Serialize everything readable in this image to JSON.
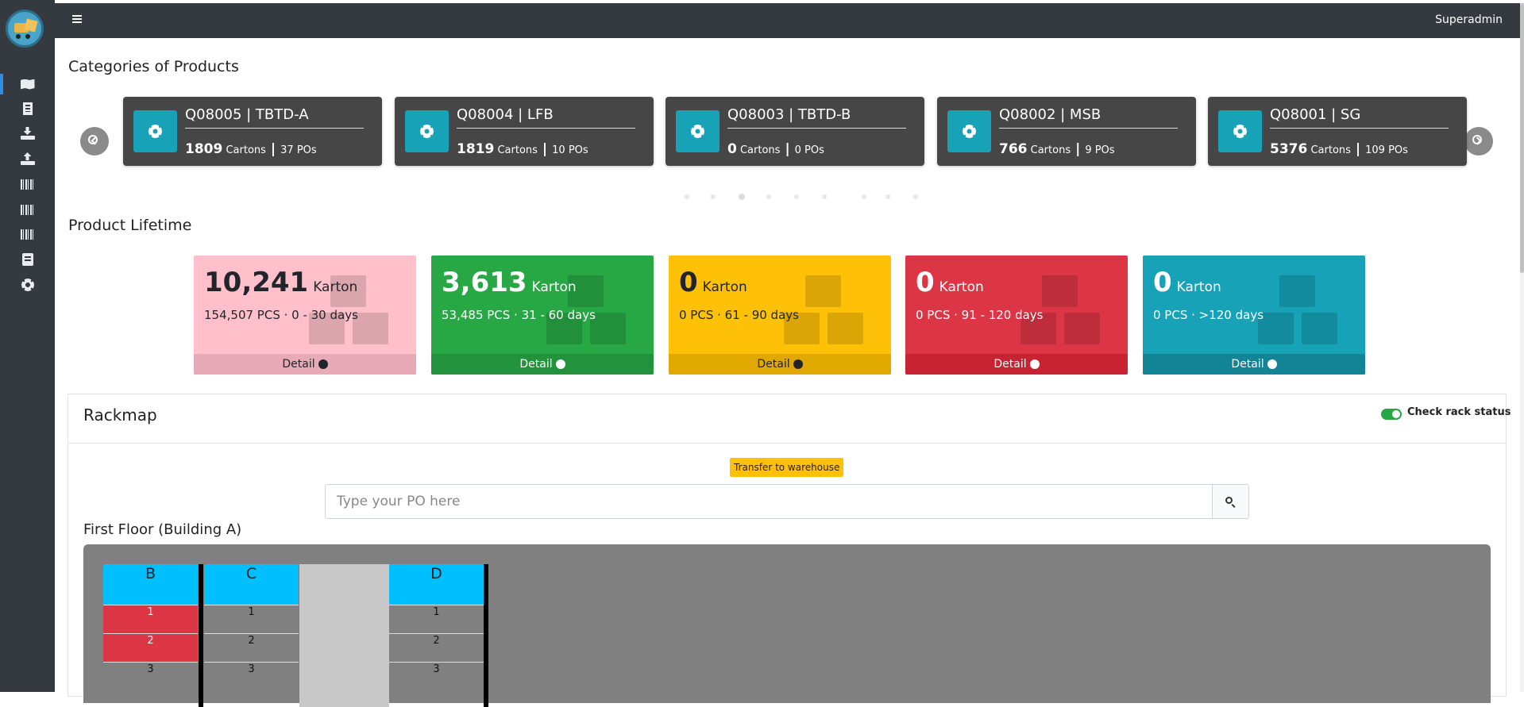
{
  "topbar": {
    "user": "Superadmin"
  },
  "sidebar": {
    "items": [
      {
        "icon": "map-icon",
        "active": true
      },
      {
        "icon": "building-icon"
      },
      {
        "icon": "download-icon"
      },
      {
        "icon": "upload-icon"
      },
      {
        "icon": "barcode-icon"
      },
      {
        "icon": "barcode-icon"
      },
      {
        "icon": "barcode-icon"
      },
      {
        "icon": "book-icon"
      },
      {
        "icon": "gear-icon"
      }
    ]
  },
  "categories": {
    "title": "Categories of Products",
    "cards": [
      {
        "code": "Q08005 | TBTD-A",
        "cartons": "1809",
        "cartons_label": "Cartons",
        "pos": "37 POs"
      },
      {
        "code": "Q08004 | LFB",
        "cartons": "1819",
        "cartons_label": "Cartons",
        "pos": "10 POs"
      },
      {
        "code": "Q08003 | TBTD-B",
        "cartons": "0",
        "cartons_label": "Cartons",
        "pos": "0 POs"
      },
      {
        "code": "Q08002 | MSB",
        "cartons": "766",
        "cartons_label": "Cartons",
        "pos": "9 POs"
      },
      {
        "code": "Q08001 | SG",
        "cartons": "5376",
        "cartons_label": "Cartons",
        "pos": "109 POs"
      }
    ]
  },
  "lifetime": {
    "title": "Product Lifetime",
    "cards": [
      {
        "value": "10,241",
        "unit": "Karton",
        "desc": "154,507 PCS · 0 - 30 days",
        "detail": "Detail",
        "bg": "#ffc0cb",
        "footer": "#e8aab6",
        "text": "#212529"
      },
      {
        "value": "3,613",
        "unit": "Karton",
        "desc": "53,485 PCS · 31 - 60 days",
        "detail": "Detail",
        "bg": "#28a745",
        "footer": "#23923d",
        "text": "#ffffff"
      },
      {
        "value": "0",
        "unit": "Karton",
        "desc": "0 PCS · 61 - 90 days",
        "detail": "Detail",
        "bg": "#ffc107",
        "footer": "#e0a800",
        "text": "#212529"
      },
      {
        "value": "0",
        "unit": "Karton",
        "desc": "0 PCS · 91 - 120 days",
        "detail": "Detail",
        "bg": "#dc3545",
        "footer": "#c82333",
        "text": "#ffffff"
      },
      {
        "value": "0",
        "unit": "Karton",
        "desc": "0 PCS · >120 days",
        "detail": "Detail",
        "bg": "#17a2b8",
        "footer": "#138496",
        "text": "#ffffff"
      }
    ]
  },
  "rackmap": {
    "title": "Rackmap",
    "toggle_label": "Check rack status",
    "toggle_on": true,
    "transfer_label": "Transfer to warehouse",
    "search_placeholder": "Type your PO here",
    "floor_title": "First Floor (Building A)",
    "columns": [
      {
        "name": "B",
        "cells": [
          {
            "label": "1",
            "status": "full"
          },
          {
            "label": "2",
            "status": "full"
          },
          {
            "label": "3",
            "status": "empty"
          }
        ]
      },
      {
        "name": "C",
        "cells": [
          {
            "label": "1",
            "status": "empty"
          },
          {
            "label": "2",
            "status": "empty"
          },
          {
            "label": "3",
            "status": "empty"
          }
        ]
      },
      {
        "name": "D",
        "cells": [
          {
            "label": "1",
            "status": "empty"
          },
          {
            "label": "2",
            "status": "empty"
          },
          {
            "label": "3",
            "status": "empty"
          }
        ]
      }
    ]
  }
}
